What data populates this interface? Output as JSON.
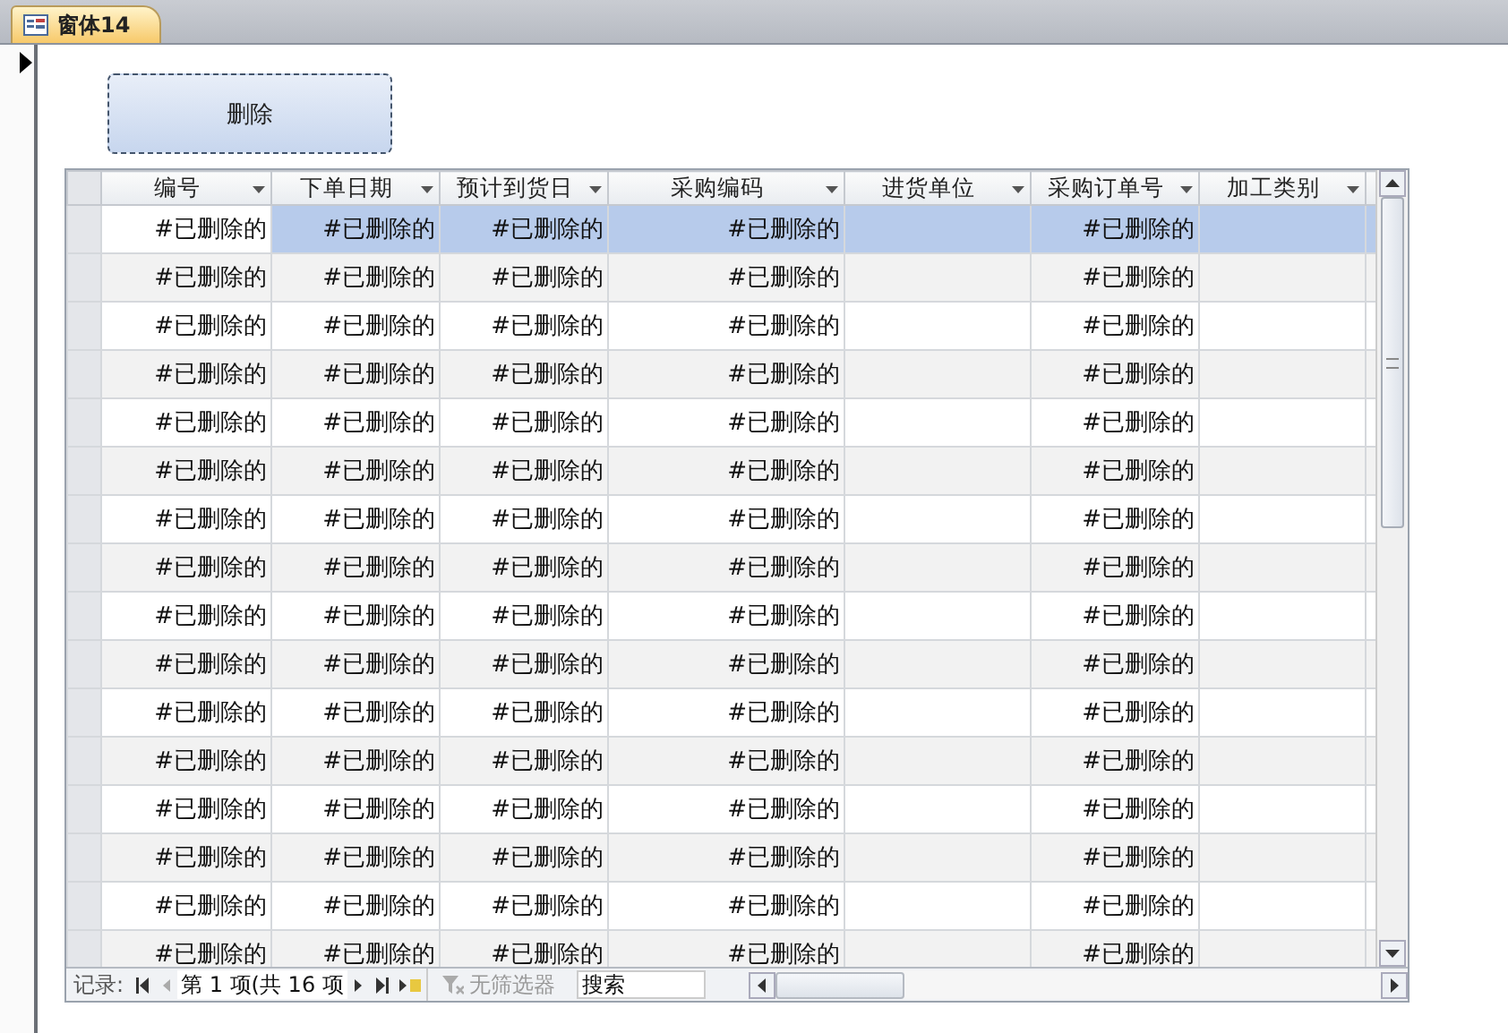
{
  "tab": {
    "title": "窗体14",
    "selected": true
  },
  "delete_button": {
    "label": "删除"
  },
  "datasheet": {
    "columns": [
      {
        "label": "编号"
      },
      {
        "label": "下单日期"
      },
      {
        "label": "预计到货日"
      },
      {
        "label": "采购编码"
      },
      {
        "label": "进货单位"
      },
      {
        "label": "采购订单号"
      },
      {
        "label": "加工类别"
      }
    ],
    "rows": [
      {
        "selected": true,
        "cells": [
          "#已删除的",
          "#已删除的",
          "#已删除的",
          "#已删除的",
          null,
          "#已删除的",
          null
        ]
      },
      {
        "selected": false,
        "cells": [
          "#已删除的",
          "#已删除的",
          "#已删除的",
          "#已删除的",
          null,
          "#已删除的",
          null
        ]
      },
      {
        "selected": false,
        "cells": [
          "#已删除的",
          "#已删除的",
          "#已删除的",
          "#已删除的",
          null,
          "#已删除的",
          null
        ]
      },
      {
        "selected": false,
        "cells": [
          "#已删除的",
          "#已删除的",
          "#已删除的",
          "#已删除的",
          null,
          "#已删除的",
          null
        ]
      },
      {
        "selected": false,
        "cells": [
          "#已删除的",
          "#已删除的",
          "#已删除的",
          "#已删除的",
          null,
          "#已删除的",
          null
        ]
      },
      {
        "selected": false,
        "cells": [
          "#已删除的",
          "#已删除的",
          "#已删除的",
          "#已删除的",
          null,
          "#已删除的",
          null
        ]
      },
      {
        "selected": false,
        "cells": [
          "#已删除的",
          "#已删除的",
          "#已删除的",
          "#已删除的",
          null,
          "#已删除的",
          null
        ]
      },
      {
        "selected": false,
        "cells": [
          "#已删除的",
          "#已删除的",
          "#已删除的",
          "#已删除的",
          null,
          "#已删除的",
          null
        ]
      },
      {
        "selected": false,
        "cells": [
          "#已删除的",
          "#已删除的",
          "#已删除的",
          "#已删除的",
          null,
          "#已删除的",
          null
        ]
      },
      {
        "selected": false,
        "cells": [
          "#已删除的",
          "#已删除的",
          "#已删除的",
          "#已删除的",
          null,
          "#已删除的",
          null
        ]
      },
      {
        "selected": false,
        "cells": [
          "#已删除的",
          "#已删除的",
          "#已删除的",
          "#已删除的",
          null,
          "#已删除的",
          null
        ]
      },
      {
        "selected": false,
        "cells": [
          "#已删除的",
          "#已删除的",
          "#已删除的",
          "#已删除的",
          null,
          "#已删除的",
          null
        ]
      },
      {
        "selected": false,
        "cells": [
          "#已删除的",
          "#已删除的",
          "#已删除的",
          "#已删除的",
          null,
          "#已删除的",
          null
        ]
      },
      {
        "selected": false,
        "cells": [
          "#已删除的",
          "#已删除的",
          "#已删除的",
          "#已删除的",
          null,
          "#已删除的",
          null
        ]
      },
      {
        "selected": false,
        "cells": [
          "#已删除的",
          "#已删除的",
          "#已删除的",
          "#已删除的",
          null,
          "#已删除的",
          null
        ]
      },
      {
        "selected": false,
        "cells": [
          "#已删除的",
          "#已删除的",
          "#已删除的",
          "#已删除的",
          null,
          "#已删除的",
          null
        ]
      }
    ],
    "navigation": {
      "label": "记录:",
      "position": "第 1 项(共 16 项",
      "filter": {
        "label": "无筛选器",
        "disabled": true
      },
      "search": {
        "placeholder": "搜索"
      }
    }
  }
}
